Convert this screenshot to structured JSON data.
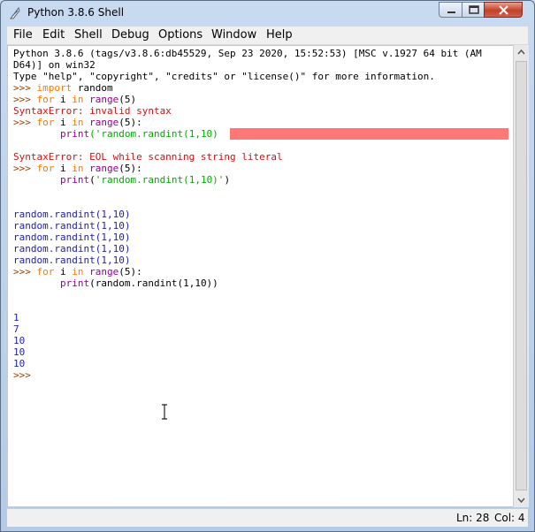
{
  "window": {
    "title": "Python 3.8.6 Shell"
  },
  "menu": [
    "File",
    "Edit",
    "Shell",
    "Debug",
    "Options",
    "Window",
    "Help"
  ],
  "shell": {
    "banner1": "Python 3.8.6 (tags/v3.8.6:db45529, Sep 23 2020, 15:52:53) [MSC v.1927 64 bit (AM",
    "banner2": "D64)] on win32",
    "banner3": "Type \"help\", \"copyright\", \"credits\" or \"license()\" for more information.",
    "prompt": ">>> ",
    "indent": "        ",
    "kw_import": "import",
    "random": " random",
    "kw_for": "for",
    "i": " i ",
    "kw_in": "in",
    "sp": " ",
    "range": "range",
    "range_args_bad": "(5)",
    "range_args": "(5):",
    "print": "print",
    "err1": "SyntaxError: invalid syntax",
    "str1": "('random.randint(1,10)",
    "err2": "SyntaxError: EOL while scanning string literal",
    "str2_open": "(",
    "str2": "'random.randint(1,10)'",
    "str2_close": ")",
    "out_line": "random.randint(1,10)",
    "print3_args": "(random.randint(1,10))",
    "nums": [
      "1",
      "7",
      "10",
      "10",
      "10"
    ],
    "final_prompt": ">>>"
  },
  "status": {
    "ln": "Ln: 28",
    "col": "Col: 4"
  }
}
